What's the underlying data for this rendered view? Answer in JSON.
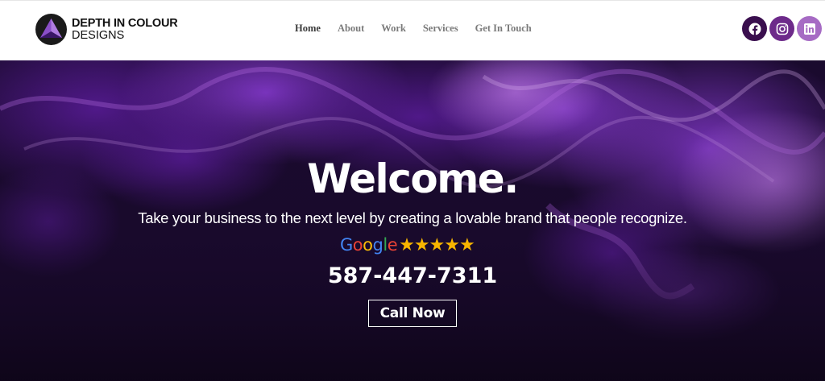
{
  "brand": {
    "name_line1": "DEPTH IN COLOUR",
    "name_line2": "DESIGNS",
    "logo_icon": "triangle-prism-logo"
  },
  "nav": {
    "items": [
      {
        "label": "Home",
        "active": true
      },
      {
        "label": "About",
        "active": false
      },
      {
        "label": "Work",
        "active": false
      },
      {
        "label": "Services",
        "active": false
      },
      {
        "label": "Get In Touch",
        "active": false
      }
    ]
  },
  "socials": [
    {
      "icon": "facebook-icon",
      "color": "#3a0f4e"
    },
    {
      "icon": "instagram-icon",
      "color": "#6d2a8a"
    },
    {
      "icon": "linkedin-icon",
      "color": "#a66bc4"
    }
  ],
  "hero": {
    "title": "Welcome.",
    "tagline": "Take your business to the next level by creating a lovable brand that people recognize.",
    "rating_source": "Google",
    "stars": "★★★★★",
    "phone": "587-447-7311",
    "cta_label": "Call Now"
  },
  "colors": {
    "accent_purple": "#7b2fbf",
    "star_gold": "#f7b500",
    "hero_dark": "#150825"
  }
}
